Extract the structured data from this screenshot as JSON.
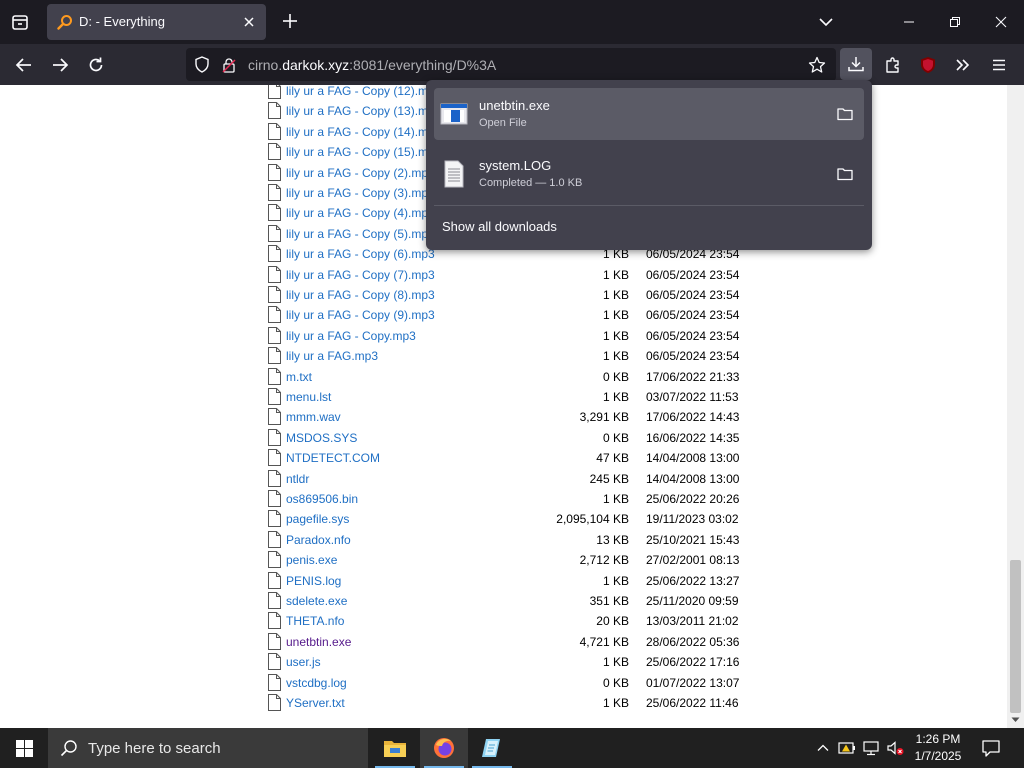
{
  "tab": {
    "title": "D: - Everything"
  },
  "url": {
    "prefix": "cirno.",
    "domain": "darkok.xyz",
    "suffix": ":8081/everything/D%3A"
  },
  "downloads": {
    "items": [
      {
        "name": "unetbtin.exe",
        "status": "Open File"
      },
      {
        "name": "system.LOG",
        "status": "Completed — 1.0 KB"
      }
    ],
    "show_all": "Show all downloads"
  },
  "files": [
    {
      "name": "lily ur a FAG - Copy (12).mp3",
      "size": "",
      "date": ""
    },
    {
      "name": "lily ur a FAG - Copy (13).mp3",
      "size": "",
      "date": ""
    },
    {
      "name": "lily ur a FAG - Copy (14).mp3",
      "size": "",
      "date": ""
    },
    {
      "name": "lily ur a FAG - Copy (15).mp3",
      "size": "",
      "date": ""
    },
    {
      "name": "lily ur a FAG - Copy (2).mp3",
      "size": "",
      "date": ""
    },
    {
      "name": "lily ur a FAG - Copy (3).mp3",
      "size": "",
      "date": ""
    },
    {
      "name": "lily ur a FAG - Copy (4).mp3",
      "size": "",
      "date": ""
    },
    {
      "name": "lily ur a FAG - Copy (5).mp3",
      "size": "",
      "date": ""
    },
    {
      "name": "lily ur a FAG - Copy (6).mp3",
      "size": "1 KB",
      "date": "06/05/2024 23:54"
    },
    {
      "name": "lily ur a FAG - Copy (7).mp3",
      "size": "1 KB",
      "date": "06/05/2024 23:54"
    },
    {
      "name": "lily ur a FAG - Copy (8).mp3",
      "size": "1 KB",
      "date": "06/05/2024 23:54"
    },
    {
      "name": "lily ur a FAG - Copy (9).mp3",
      "size": "1 KB",
      "date": "06/05/2024 23:54"
    },
    {
      "name": "lily ur a FAG - Copy.mp3",
      "size": "1 KB",
      "date": "06/05/2024 23:54"
    },
    {
      "name": "lily ur a FAG.mp3",
      "size": "1 KB",
      "date": "06/05/2024 23:54"
    },
    {
      "name": "m.txt",
      "size": "0 KB",
      "date": "17/06/2022 21:33"
    },
    {
      "name": "menu.lst",
      "size": "1 KB",
      "date": "03/07/2022 11:53"
    },
    {
      "name": "mmm.wav",
      "size": "3,291 KB",
      "date": "17/06/2022 14:43"
    },
    {
      "name": "MSDOS.SYS",
      "size": "0 KB",
      "date": "16/06/2022 14:35"
    },
    {
      "name": "NTDETECT.COM",
      "size": "47 KB",
      "date": "14/04/2008 13:00"
    },
    {
      "name": "ntldr",
      "size": "245 KB",
      "date": "14/04/2008 13:00"
    },
    {
      "name": "os869506.bin",
      "size": "1 KB",
      "date": "25/06/2022 20:26"
    },
    {
      "name": "pagefile.sys",
      "size": "2,095,104 KB",
      "date": "19/11/2023 03:02"
    },
    {
      "name": "Paradox.nfo",
      "size": "13 KB",
      "date": "25/10/2021 15:43"
    },
    {
      "name": "penis.exe",
      "size": "2,712 KB",
      "date": "27/02/2001 08:13"
    },
    {
      "name": "PENIS.log",
      "size": "1 KB",
      "date": "25/06/2022 13:27"
    },
    {
      "name": "sdelete.exe",
      "size": "351 KB",
      "date": "25/11/2020 09:59"
    },
    {
      "name": "THETA.nfo",
      "size": "20 KB",
      "date": "13/03/2011 21:02"
    },
    {
      "name": "unetbtin.exe",
      "size": "4,721 KB",
      "date": "28/06/2022 05:36"
    },
    {
      "name": "user.js",
      "size": "1 KB",
      "date": "25/06/2022 17:16"
    },
    {
      "name": "vstcdbg.log",
      "size": "0 KB",
      "date": "01/07/2022 13:07"
    },
    {
      "name": "YServer.txt",
      "size": "1 KB",
      "date": "25/06/2022 11:46"
    }
  ],
  "taskbar": {
    "search_placeholder": "Type here to search",
    "time": "1:26 PM",
    "date": "1/7/2025"
  },
  "colors": {
    "link": "#1f6fc4",
    "visited": "#551a8b",
    "tab_bg": "#1c1b22",
    "nav_bg": "#2b2a33",
    "panel_bg": "#42414d"
  }
}
